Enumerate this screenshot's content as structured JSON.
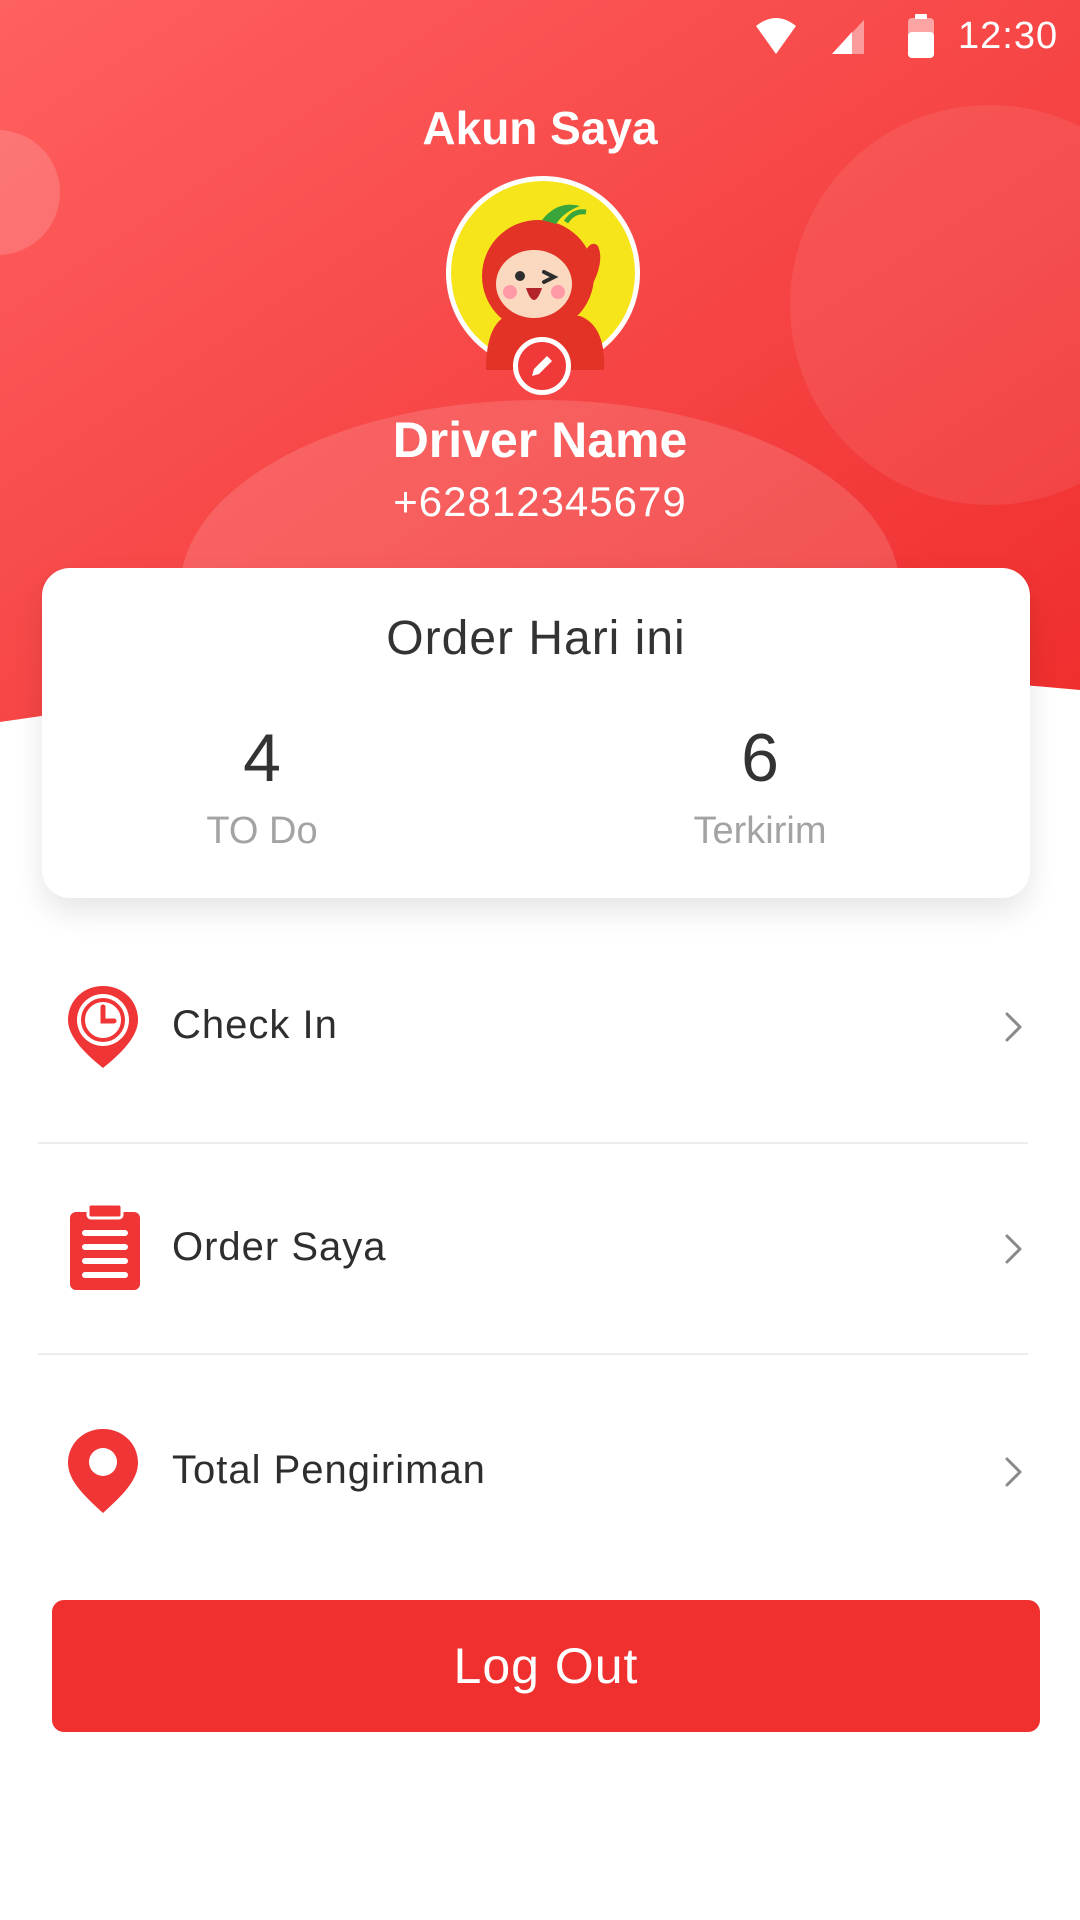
{
  "theme": {
    "primary": "#f02f2f",
    "header_gradient_start": "#ff5e5e",
    "header_gradient_end": "#f02f2f",
    "text": "#2e2e2e",
    "muted_text": "#a3a3a3"
  },
  "status_bar": {
    "time": "12:30",
    "icons": [
      "wifi-icon",
      "cellular-signal-icon",
      "battery-icon"
    ]
  },
  "header": {
    "title": "Akun Saya"
  },
  "profile": {
    "avatar": "tomato-mascot-avatar",
    "edit_icon": "pencil-icon",
    "name": "Driver Name",
    "phone": "+62812345679"
  },
  "order_summary": {
    "title": "Order Hari ini",
    "stats": [
      {
        "value": "4",
        "label": "TO Do"
      },
      {
        "value": "6",
        "label": "Terkirim"
      }
    ]
  },
  "menu": {
    "items": [
      {
        "label": "Check In",
        "icon": "clock-pin-icon"
      },
      {
        "label": "Order Saya",
        "icon": "clipboard-icon"
      },
      {
        "label": "Total Pengiriman",
        "icon": "location-pin-icon"
      }
    ],
    "chevron_icon": "chevron-right-icon"
  },
  "logout": {
    "label": "Log Out"
  }
}
